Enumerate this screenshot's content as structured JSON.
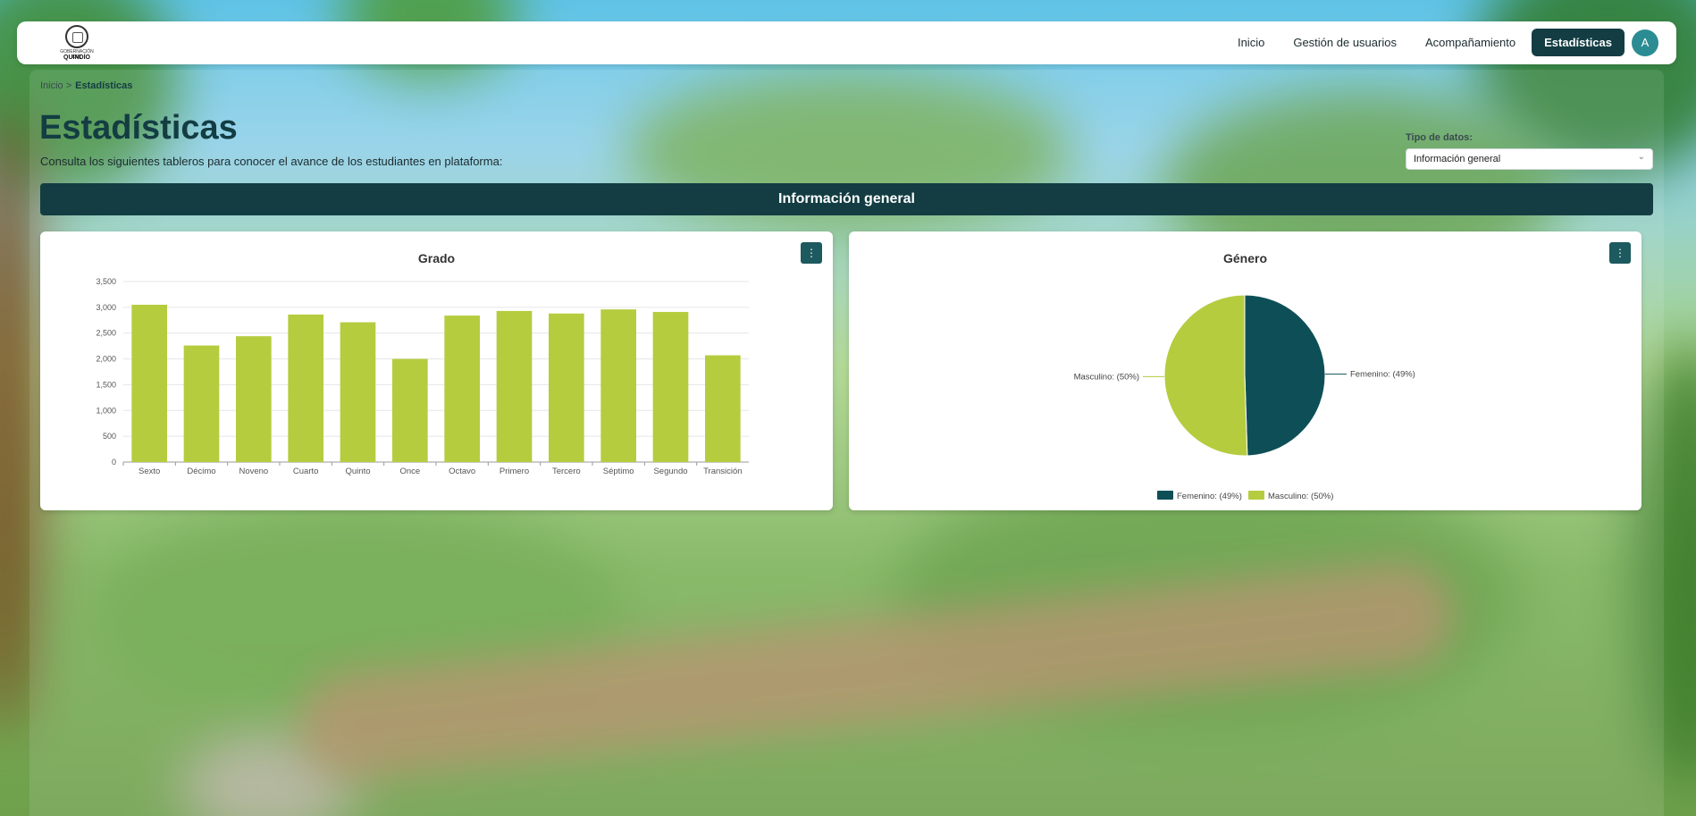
{
  "nav": {
    "logo": {
      "line1": "GOBERNACIÓN DEL",
      "line2": "QUINDÍO"
    },
    "items": [
      {
        "label": "Inicio",
        "active": false
      },
      {
        "label": "Gestión de usuarios",
        "active": false
      },
      {
        "label": "Acompañamiento",
        "active": false
      },
      {
        "label": "Estadísticas",
        "active": true
      }
    ],
    "avatar": "A"
  },
  "breadcrumb": {
    "home": "Inicio >",
    "current": "Estadísticas"
  },
  "page": {
    "title": "Estadísticas",
    "subtitle": "Consulta los siguientes tableros para conocer el avance de los estudiantes en plataforma:"
  },
  "filter": {
    "label": "Tipo de datos:",
    "value": "Información general"
  },
  "banner": "Información general",
  "cards": {
    "grado": {
      "menu_icon": "⋮"
    },
    "genero": {
      "menu_icon": "⋮"
    }
  },
  "chart_data": [
    {
      "type": "bar",
      "title": "Grado",
      "categories": [
        "Sexto",
        "Décimo",
        "Noveno",
        "Cuarto",
        "Quinto",
        "Once",
        "Octavo",
        "Primero",
        "Tercero",
        "Séptimo",
        "Segundo",
        "Transición"
      ],
      "values": [
        3050,
        2260,
        2440,
        2860,
        2710,
        2000,
        2840,
        2930,
        2880,
        2960,
        2910,
        2070
      ],
      "ylim": [
        0,
        3500
      ],
      "yticks": [
        0,
        500,
        1000,
        1500,
        2000,
        2500,
        3000,
        3500
      ],
      "ytick_labels": [
        "0",
        "500",
        "1,000",
        "1,500",
        "2,000",
        "2,500",
        "3,000",
        "3,500"
      ],
      "grid": true,
      "color": "#b5cc3f"
    },
    {
      "type": "pie",
      "title": "Género",
      "slices": [
        {
          "label": "Femenino: (49%)",
          "value": 49,
          "color": "#0e4f57"
        },
        {
          "label": "Masculino: (50%)",
          "value": 50,
          "color": "#b5cc3f"
        }
      ],
      "legend": "bottom"
    }
  ]
}
